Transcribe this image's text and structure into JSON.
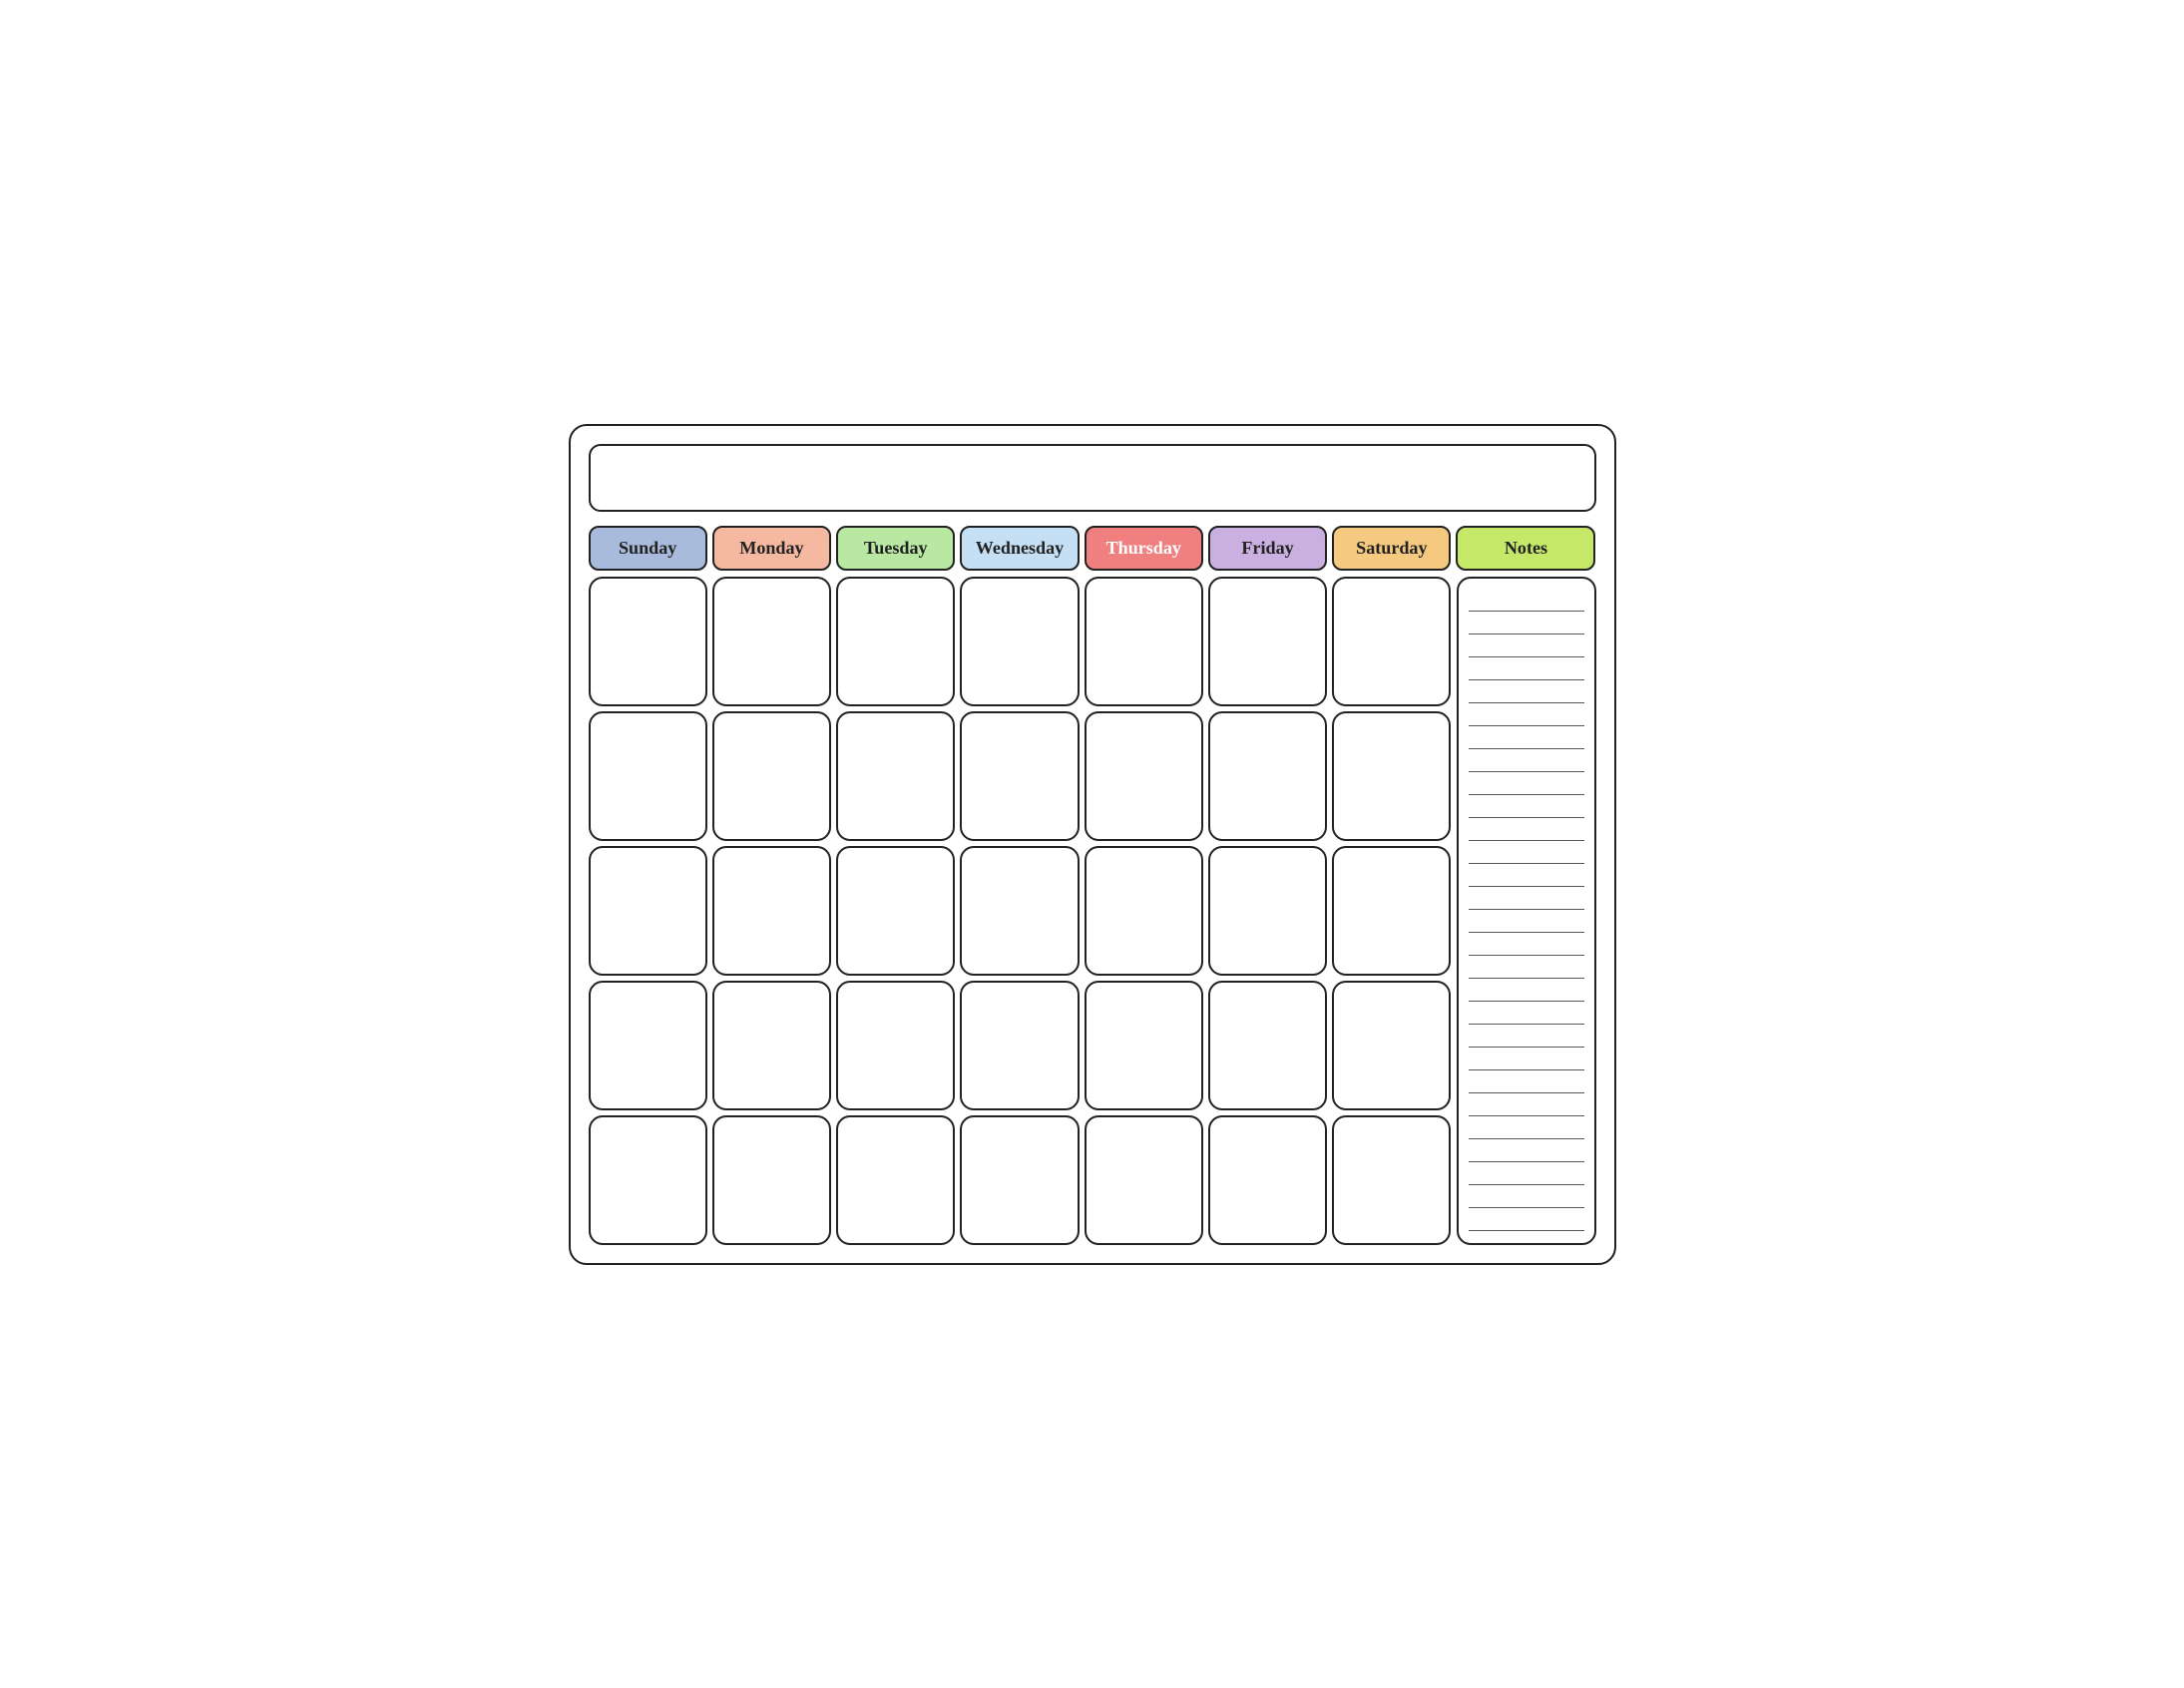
{
  "title": "",
  "header": {
    "days": [
      {
        "label": "Sunday",
        "class": "sunday"
      },
      {
        "label": "Monday",
        "class": "monday"
      },
      {
        "label": "Tuesday",
        "class": "tuesday"
      },
      {
        "label": "Wednesday",
        "class": "wednesday"
      },
      {
        "label": "Thursday",
        "class": "thursday"
      },
      {
        "label": "Friday",
        "class": "friday"
      },
      {
        "label": "Saturday",
        "class": "saturday"
      }
    ],
    "notes_label": "Notes"
  },
  "rows": 5,
  "cols": 7,
  "notes_lines": 28
}
